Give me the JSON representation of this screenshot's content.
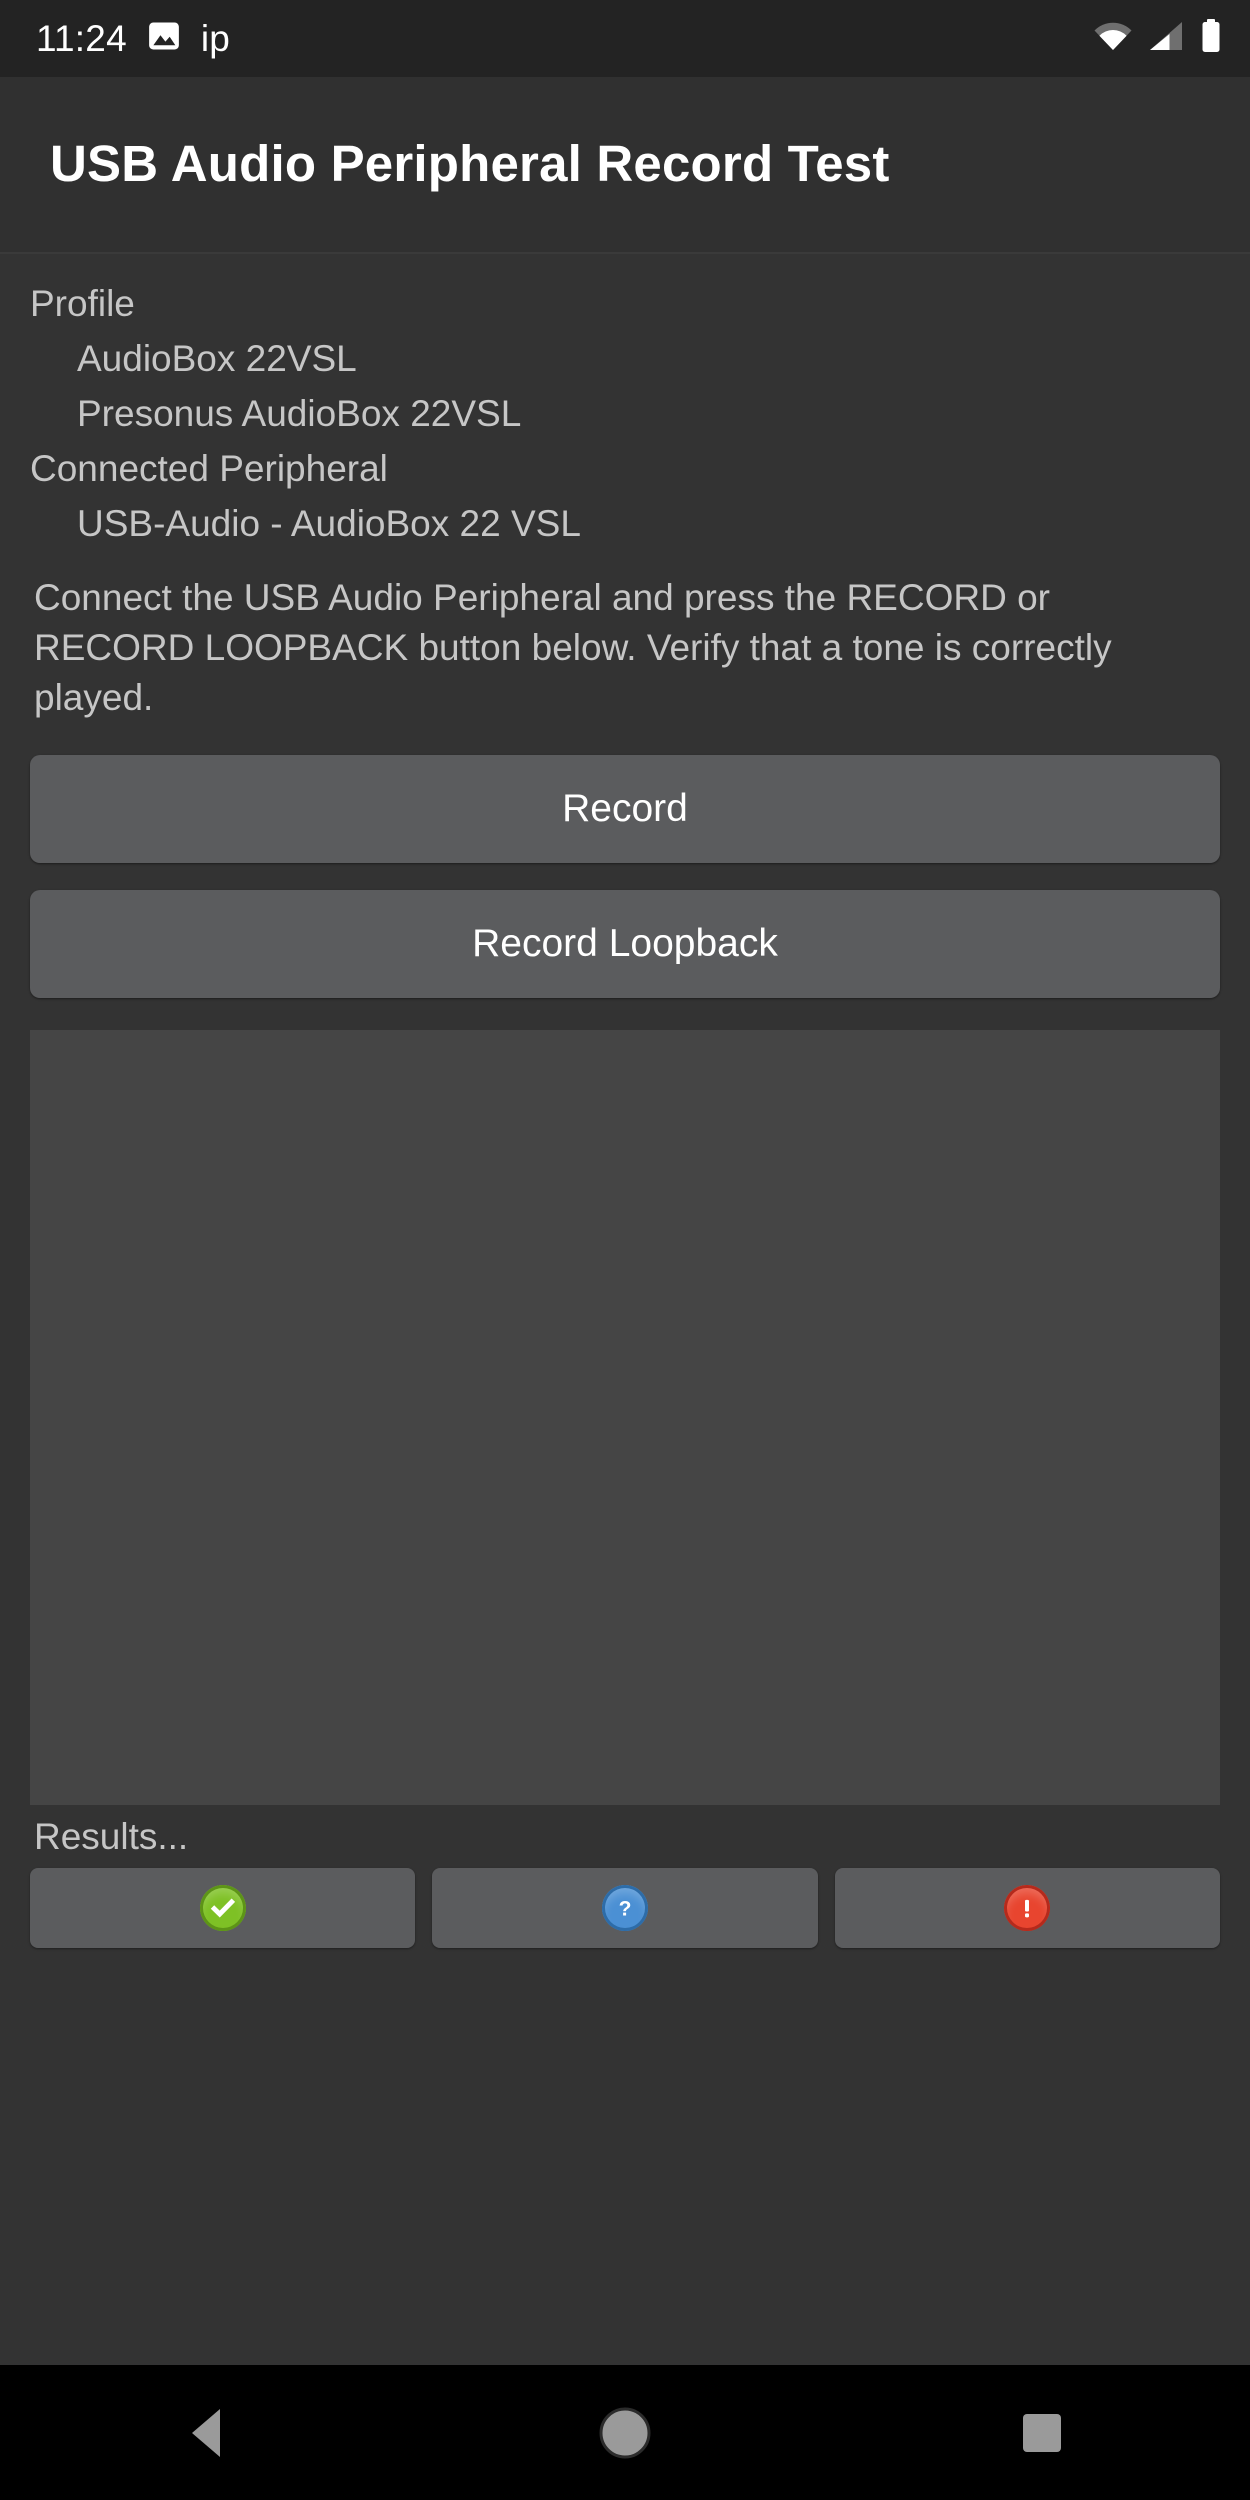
{
  "status_bar": {
    "clock": "11:24",
    "left_icons": [
      "image-icon"
    ],
    "left_text": "ip",
    "right_icons": [
      "wifi-icon",
      "cellular-signal-icon",
      "battery-icon"
    ]
  },
  "app_bar": {
    "title": "USB Audio Peripheral Record Test"
  },
  "info": {
    "profile_label": "Profile",
    "profile_name": "AudioBox 22VSL",
    "profile_product": "Presonus AudioBox 22VSL",
    "connected_label": "Connected Peripheral",
    "connected_device": "USB-Audio - AudioBox 22 VSL"
  },
  "instructions": {
    "text": "Connect the USB Audio Peripheral and press the RECORD or RECORD LOOPBACK button below. Verify that a tone is correctly played."
  },
  "buttons": {
    "record": "Record",
    "record_loopback": "Record Loopback"
  },
  "results": {
    "area_text": "",
    "label": "Results...",
    "actions": [
      {
        "name": "pass",
        "icon": "check-circle-icon",
        "color": "#7ec125",
        "border": "#5d9417"
      },
      {
        "name": "info",
        "icon": "question-circle-icon",
        "color": "#4b90d4",
        "border": "#2d6ca8"
      },
      {
        "name": "fail",
        "icon": "exclamation-circle-icon",
        "color": "#e8452f",
        "border": "#b52a1c"
      }
    ]
  },
  "nav_bar": {
    "back": "back-icon",
    "home": "home-icon",
    "recents": "recents-icon"
  },
  "colors": {
    "window_bg": "#333333",
    "app_bar_bg": "#303030",
    "status_bar_bg": "#232323",
    "button_bg": "#5b5c5e",
    "results_bg": "#454545",
    "text_primary": "#ffffff",
    "text_secondary": "#c6c6c6",
    "nav_bg": "#000000"
  }
}
